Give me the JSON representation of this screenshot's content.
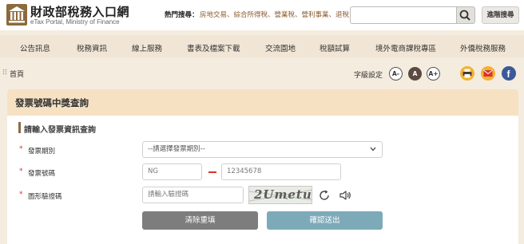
{
  "header": {
    "site_title": "財政部稅務入口網",
    "site_subtitle": "eTax Portal, Ministry of Finance",
    "hot_search_label": "熱門搜尋：",
    "hot_search_links": "房地交易、綜合所得稅、營業稅、營利事業、退稅",
    "search_placeholder": "",
    "advanced_search_label": "進階搜尋"
  },
  "nav": {
    "items": [
      "公告訊息",
      "稅務資訊",
      "線上服務",
      "書表及檔案下載",
      "交流園地",
      "稅額試算",
      "境外電商課稅專區",
      "外僑稅務服務"
    ]
  },
  "breadcrumb": {
    "home": "首頁"
  },
  "font_size": {
    "label": "字級設定",
    "smaller": "A-",
    "normal": "A",
    "larger": "A+"
  },
  "panel": {
    "title": "發票號碼中獎查詢",
    "section_title": "請輸入發票資訊查詢",
    "required_mark": "*",
    "period_label": "發票期別",
    "period_selected": "--請選擇發票期別--",
    "number_label": "發票號碼",
    "number_prefix_placeholder": "NG",
    "number_digits_placeholder": "12345678",
    "captcha_label": "圖形驗證碼",
    "captcha_placeholder": "請輸入驗證碼",
    "captcha_image_text": "2Umetu",
    "clear_button": "清除重填",
    "submit_button": "確認送出"
  },
  "colors": {
    "page_bg": "#f4ecdf",
    "nav_bg": "#f1e6d6",
    "panel_head_bg": "#f6e1c3",
    "required": "#d9332e",
    "clear_button": "#7d7d7d",
    "submit_button": "#7daab8",
    "facebook": "#3b5998"
  }
}
